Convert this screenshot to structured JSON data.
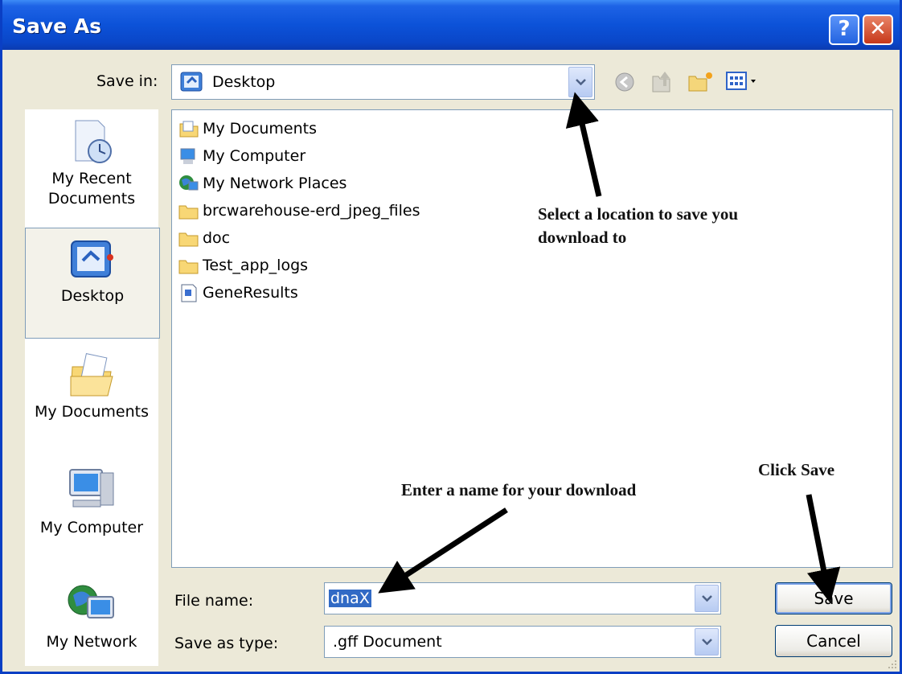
{
  "window": {
    "title": "Save As"
  },
  "titlebar": {
    "help_label": "?",
    "close_label": "✕"
  },
  "toolbar": {
    "save_in_label": "Save in:",
    "save_in_value": "Desktop",
    "icons": [
      "back-icon",
      "up-folder-icon",
      "new-folder-icon",
      "views-menu-icon"
    ]
  },
  "places": [
    {
      "label": "My Recent Documents",
      "icon": "recent-documents-icon"
    },
    {
      "label": "Desktop",
      "icon": "desktop-icon",
      "selected": true
    },
    {
      "label": "My Documents",
      "icon": "my-documents-icon"
    },
    {
      "label": "My Computer",
      "icon": "my-computer-icon"
    },
    {
      "label": "My Network",
      "icon": "my-network-icon"
    }
  ],
  "files": [
    {
      "name": "My Documents",
      "icon": "my-documents-icon"
    },
    {
      "name": "My Computer",
      "icon": "my-computer-icon"
    },
    {
      "name": "My Network Places",
      "icon": "network-places-icon"
    },
    {
      "name": "brcwarehouse-erd_jpeg_files",
      "icon": "folder-icon"
    },
    {
      "name": "doc",
      "icon": "folder-icon"
    },
    {
      "name": "Test_app_logs",
      "icon": "folder-icon"
    },
    {
      "name": "GeneResults",
      "icon": "document-icon"
    }
  ],
  "form": {
    "filename_label": "File name:",
    "filename_value": "dnaX",
    "type_label": "Save as type:",
    "type_value": ".gff Document"
  },
  "buttons": {
    "save": "Save",
    "cancel": "Cancel"
  },
  "annotations": {
    "location_line1": "Select a location to save you",
    "location_line2": "download to",
    "name_hint": "Enter a name for your download",
    "save_hint": "Click Save"
  }
}
